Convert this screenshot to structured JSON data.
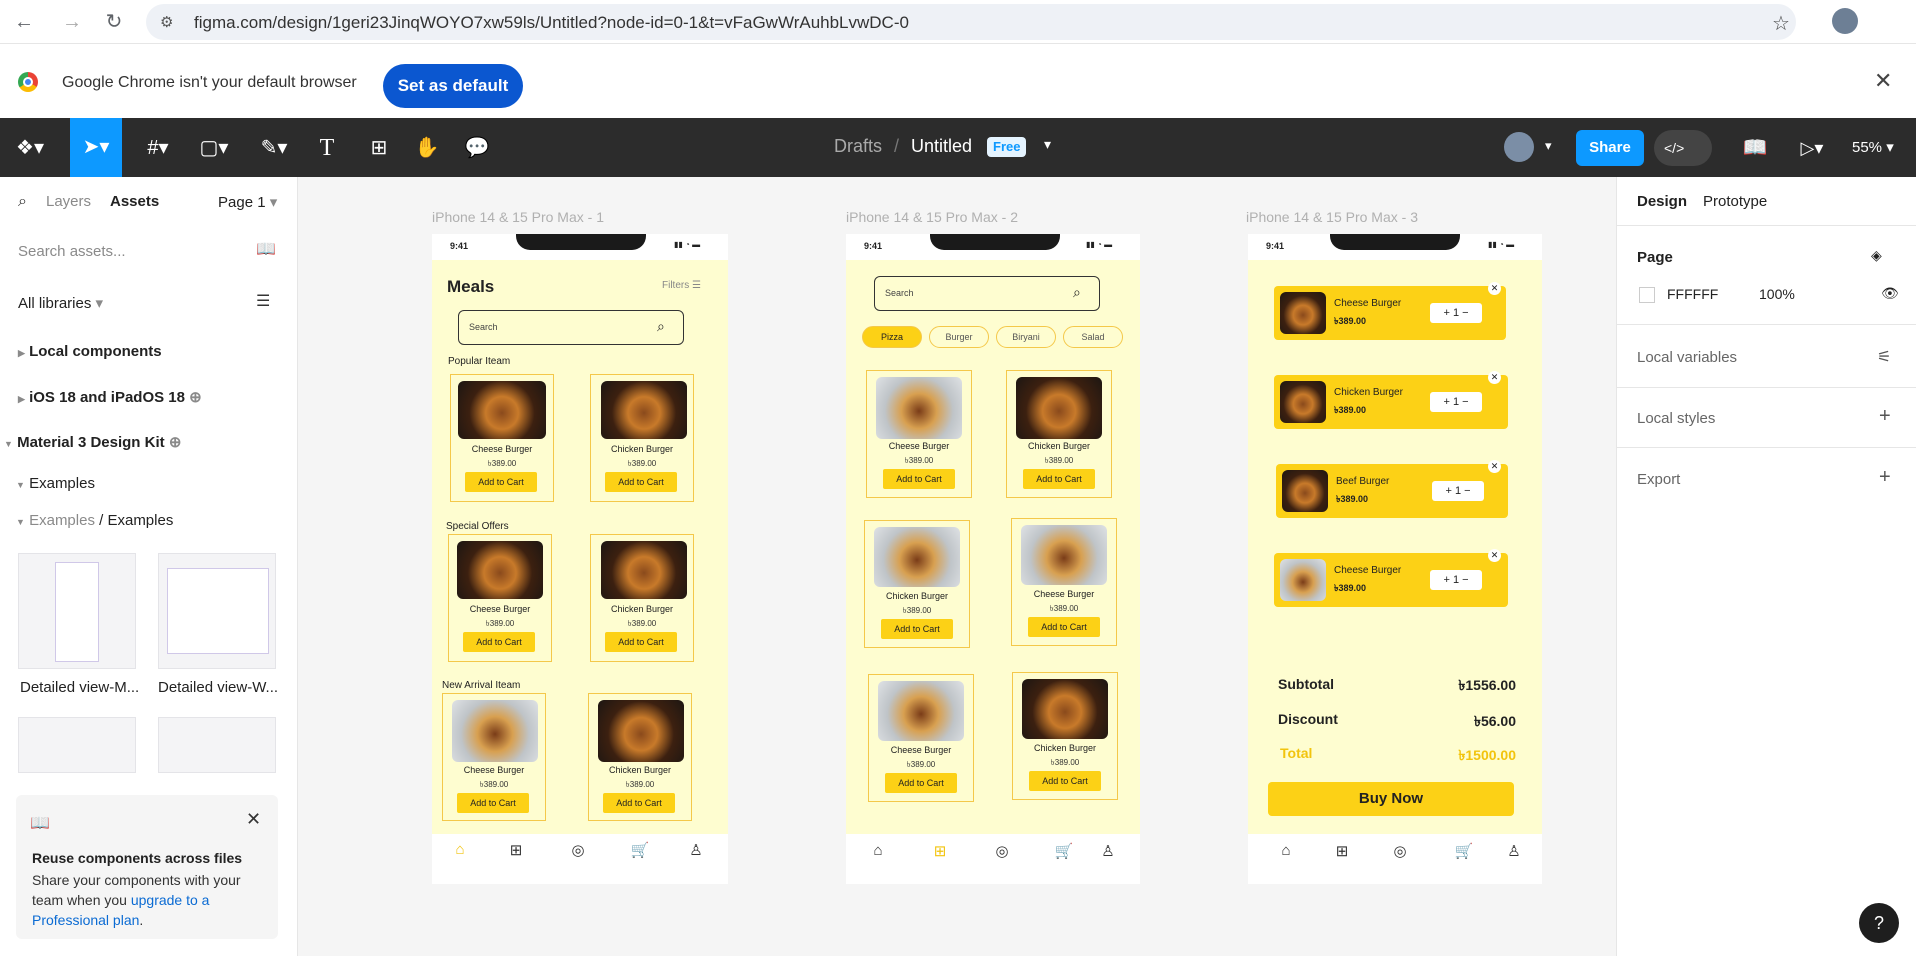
{
  "browser": {
    "url": "figma.com/design/1geri23JinqWOYO7xw59ls/Untitled?node-id=0-1&t=vFaGwWrAuhbLvwDC-0",
    "infobar_text": "Google Chrome isn't your default browser",
    "set_default_label": "Set as default"
  },
  "toolbar": {
    "breadcrumb_drafts": "Drafts",
    "breadcrumb_sep": "/",
    "file_name": "Untitled",
    "plan_badge": "Free",
    "share_label": "Share",
    "zoom": "55%"
  },
  "left_panel": {
    "tab_layers": "Layers",
    "tab_assets": "Assets",
    "page_selector": "Page 1",
    "search_placeholder": "Search assets...",
    "libraries": "All libraries",
    "sections": [
      "Local components",
      "iOS 18 and iPadOS 18",
      "Material 3 Design Kit"
    ],
    "examples": "Examples",
    "examples_path_parent": "Examples",
    "examples_path_child": "Examples",
    "thumb_labels": [
      "Detailed view-M...",
      "Detailed view-W..."
    ],
    "promo": {
      "title": "Reuse components across files",
      "body": "Share your components with your team when you ",
      "link": "upgrade to a Professional plan",
      "tail": "."
    }
  },
  "right_panel": {
    "tab_design": "Design",
    "tab_prototype": "Prototype",
    "page_heading": "Page",
    "page_color": "FFFFFF",
    "page_opacity": "100%",
    "local_variables": "Local variables",
    "local_styles": "Local styles",
    "export": "Export"
  },
  "frames": {
    "labels": [
      "iPhone 14 & 15 Pro Max - 1",
      "iPhone 14 & 15 Pro Max - 2",
      "iPhone 14 & 15 Pro Max - 3"
    ],
    "status_time": "9:41",
    "frame1": {
      "title": "Meals",
      "filters": "Filters",
      "search": "Search",
      "section_popular": "Popular Iteam",
      "section_offers": "Special Offers",
      "section_new": "New Arrival Iteam",
      "items": [
        {
          "name": "Cheese Burger",
          "price": "৳389.00",
          "btn": "Add to Cart"
        },
        {
          "name": "Chicken Burger",
          "price": "৳389.00",
          "btn": "Add to Cart"
        },
        {
          "name": "Cheese Burger",
          "price": "৳389.00",
          "btn": "Add to Cart"
        },
        {
          "name": "Chicken Burger",
          "price": "৳389.00",
          "btn": "Add to Cart"
        },
        {
          "name": "Cheese Burger",
          "price": "৳389.00",
          "btn": "Add to Cart"
        },
        {
          "name": "Chicken Burger",
          "price": "৳389.00",
          "btn": "Add to Cart"
        }
      ]
    },
    "frame2": {
      "search": "Search",
      "categories": [
        "Pizza",
        "Burger",
        "Biryani",
        "Salad"
      ],
      "items": [
        {
          "name": "Cheese Burger",
          "price": "৳389.00",
          "btn": "Add to Cart"
        },
        {
          "name": "Chicken Burger",
          "price": "৳389.00",
          "btn": "Add to Cart"
        },
        {
          "name": "Chicken Burger",
          "price": "৳389.00",
          "btn": "Add to Cart"
        },
        {
          "name": "Cheese Burger",
          "price": "৳389.00",
          "btn": "Add to Cart"
        },
        {
          "name": "Cheese Burger",
          "price": "৳389.00",
          "btn": "Add to Cart"
        },
        {
          "name": "Chicken Burger",
          "price": "৳389.00",
          "btn": "Add to Cart"
        }
      ]
    },
    "frame3": {
      "cart": [
        {
          "name": "Cheese Burger",
          "price": "৳389.00",
          "qty": "1"
        },
        {
          "name": "Chicken Burger",
          "price": "৳389.00",
          "qty": "1"
        },
        {
          "name": "Beef Burger",
          "price": "৳389.00",
          "qty": "1"
        },
        {
          "name": "Cheese Burger",
          "price": "৳389.00",
          "qty": "1"
        }
      ],
      "subtotal_label": "Subtotal",
      "subtotal_value": "৳1556.00",
      "discount_label": "Discount",
      "discount_value": "৳56.00",
      "total_label": "Total",
      "total_value": "৳1500.00",
      "buy_label": "Buy Now"
    }
  },
  "help_label": "?"
}
